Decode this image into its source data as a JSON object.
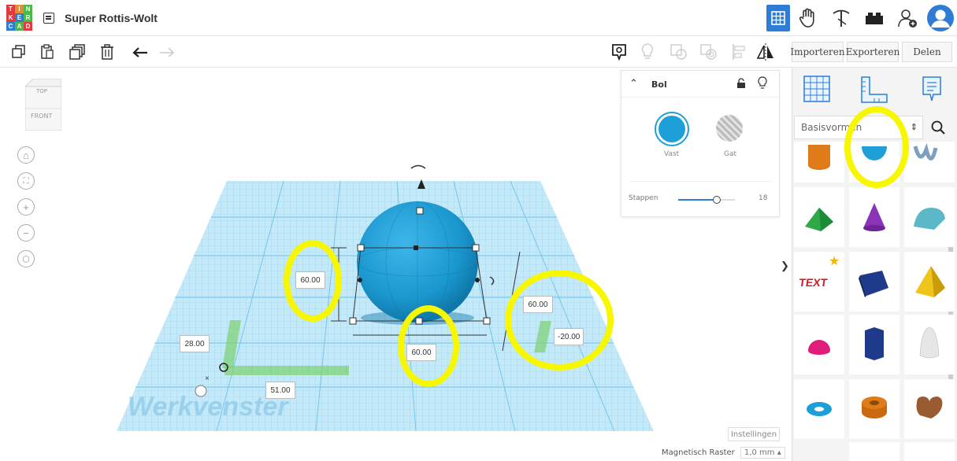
{
  "app": {
    "title": "Super Rottis-Wolt",
    "logo_letters": [
      "T",
      "I",
      "N",
      "K",
      "E",
      "R",
      "C",
      "A",
      "D"
    ],
    "logo_colors": [
      "#e03a3e",
      "#e78b2e",
      "#4cb84a",
      "#e03a3e",
      "#2e7cd6",
      "#4cb84a",
      "#2e7cd6",
      "#4cb84a",
      "#e03a3e"
    ]
  },
  "toolbar": {
    "import_label": "Importeren",
    "export_label": "Exporteren",
    "share_label": "Delen"
  },
  "viewcube": {
    "top": "TOP",
    "front": "FRONT"
  },
  "inspector": {
    "shape_name": "Bol",
    "solid_label": "Vast",
    "hole_label": "Gat",
    "steps_label": "Stappen",
    "steps_value": "18",
    "solid_color": "#1e9fd8"
  },
  "dimensions": {
    "height": "60.00",
    "width": "60.00",
    "depth": "60.00",
    "elevation": "-20.00",
    "pos_y": "28.00",
    "pos_x": "51.00"
  },
  "workplane": {
    "label": "Werkvenster",
    "settings_label": "Instellingen",
    "snap_label": "Magnetisch Raster",
    "snap_value": "1,0 mm"
  },
  "sidebar": {
    "category": "Basisvormen",
    "collapse_glyph": "❯"
  }
}
